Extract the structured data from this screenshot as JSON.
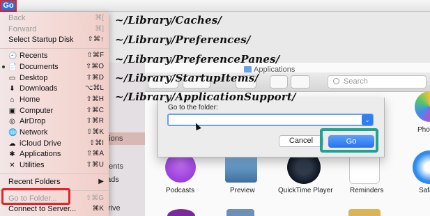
{
  "menubar": {
    "go_label": "Go"
  },
  "go_menu": {
    "top_items": [
      {
        "label": "Back",
        "shortcut": "⌘[",
        "disabled": true
      },
      {
        "label": "Forward",
        "shortcut": "⌘]",
        "disabled": true
      },
      {
        "label": "Select Startup Disk",
        "shortcut": "⇧⌘↑",
        "disabled": false
      }
    ],
    "places": [
      {
        "label": "Recents",
        "shortcut": "⇧⌘F",
        "icon": "recents-icon"
      },
      {
        "label": "Documents",
        "shortcut": "⇧⌘O",
        "icon": "documents-icon"
      },
      {
        "label": "Desktop",
        "shortcut": "⇧⌘D",
        "icon": "desktop-icon"
      },
      {
        "label": "Downloads",
        "shortcut": "⌥⌘L",
        "icon": "downloads-icon"
      },
      {
        "label": "Home",
        "shortcut": "⇧⌘H",
        "icon": "home-icon"
      },
      {
        "label": "Computer",
        "shortcut": "⇧⌘C",
        "icon": "computer-icon"
      },
      {
        "label": "AirDrop",
        "shortcut": "⇧⌘R",
        "icon": "airdrop-icon"
      },
      {
        "label": "Network",
        "shortcut": "⇧⌘K",
        "icon": "network-icon"
      },
      {
        "label": "iCloud Drive",
        "shortcut": "⇧⌘I",
        "icon": "icloud-icon"
      },
      {
        "label": "Applications",
        "shortcut": "⇧⌘A",
        "icon": "applications-icon"
      },
      {
        "label": "Utilities",
        "shortcut": "⇧⌘U",
        "icon": "utilities-icon"
      }
    ],
    "recent_folders": {
      "label": "Recent Folders",
      "arrow": "▶"
    },
    "goto_folder": {
      "label": "Go to Folder...",
      "shortcut": "⇧⌘G"
    },
    "connect_server": {
      "label": "Connect to Server...",
      "shortcut": "⌘K"
    }
  },
  "paths": [
    "~/Library/Caches/",
    "~/Library/Preferences/",
    "~/Library/PreferencePanes/",
    "~/Library/StartupItems/",
    "~/Library/ApplicationSupport/"
  ],
  "finder": {
    "title": "Applications",
    "search_placeholder": "Search",
    "sidebar_fragments": [
      "p",
      "ts",
      "ations",
      "ments",
      "oads",
      "Drive"
    ],
    "apps_row1": [
      "Podcasts",
      "Preview",
      "QuickTime Player",
      "Reminders",
      "Safa"
    ],
    "apps_top_right": "Phot"
  },
  "dialog": {
    "label": "Go to the folder:",
    "input_value": "",
    "combo_arrow": "⌄",
    "cancel_label": "Cancel",
    "go_label": "Go"
  },
  "colors": {
    "accent_blue": "#2f6fde",
    "highlight_red": "#e0252b",
    "highlight_teal": "#1da394"
  }
}
